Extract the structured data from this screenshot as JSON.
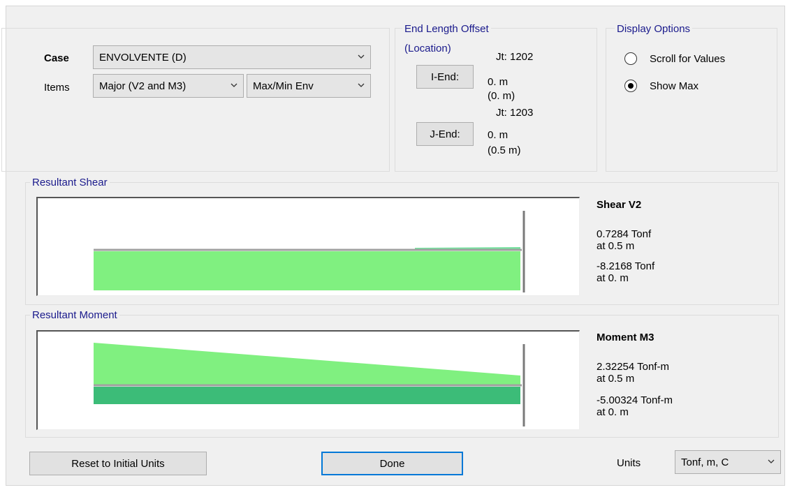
{
  "case": {
    "label": "Case",
    "value": "ENVOLVENTE (D)"
  },
  "items": {
    "label": "Items",
    "component": "Major (V2 and M3)",
    "envelope": "Max/Min Env"
  },
  "end_offset": {
    "title": "End Length Offset",
    "subtitle": "(Location)",
    "i_end_button": "I-End:",
    "i_joint": "Jt: 1202",
    "i_offset": "0. m",
    "i_location": "(0. m)",
    "j_end_button": "J-End:",
    "j_joint": "Jt: 1203",
    "j_offset": "0. m",
    "j_location": "(0.5 m)"
  },
  "display_options": {
    "title": "Display Options",
    "scroll_label": "Scroll for Values",
    "show_max_label": "Show Max",
    "selected": "show_max"
  },
  "shear": {
    "title": "Resultant Shear",
    "heading": "Shear V2",
    "max_value": "0.7284 Tonf",
    "max_at": "at 0.5 m",
    "min_value": "-8.2168 Tonf",
    "min_at": "at 0. m"
  },
  "moment": {
    "title": "Resultant Moment",
    "heading": "Moment M3",
    "max_value": "2.32254 Tonf-m",
    "max_at": "at 0.5 m",
    "min_value": "-5.00324 Tonf-m",
    "min_at": "at 0. m"
  },
  "footer": {
    "reset_button": "Reset to Initial Units",
    "done_button": "Done",
    "units_label": "Units",
    "units_value": "Tonf, m, C"
  },
  "colors": {
    "light_fill": "#80f080",
    "dark_fill": "#3cbc78",
    "baseline": "#a0a0a0",
    "group_title": "#1a1a8c",
    "default_border": "#0078d7"
  }
}
